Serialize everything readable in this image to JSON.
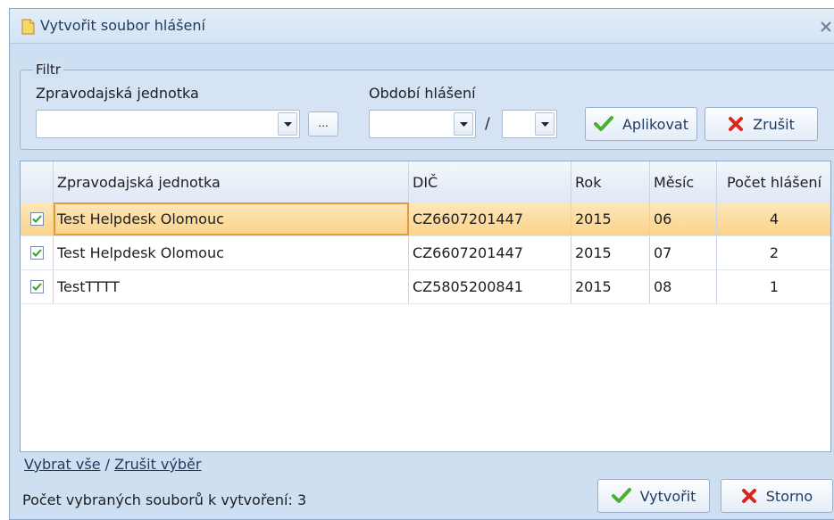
{
  "window": {
    "title": "Vytvořit soubor hlášení"
  },
  "filter": {
    "legend": "Filtr",
    "unit_label": "Zpravodajská jednotka",
    "unit_value": "",
    "period_label": "Období hlášení",
    "year_value": "",
    "month_value": "",
    "separator": "/",
    "browse_label": "...",
    "apply_label": "Aplikovat",
    "cancel_label": "Zrušit"
  },
  "grid": {
    "columns": [
      "",
      "Zpravodajská jednotka",
      "DIČ",
      "Rok",
      "Měsíc",
      "Počet hlášení"
    ],
    "rows": [
      {
        "checked": true,
        "unit": "Test Helpdesk Olomouc",
        "dic": "CZ6607201447",
        "year": "2015",
        "month": "06",
        "count": "4",
        "selected": true
      },
      {
        "checked": true,
        "unit": "Test Helpdesk Olomouc",
        "dic": "CZ6607201447",
        "year": "2015",
        "month": "07",
        "count": "2",
        "selected": false
      },
      {
        "checked": true,
        "unit": "TestTTTT",
        "dic": "CZ5805200841",
        "year": "2015",
        "month": "08",
        "count": "1",
        "selected": false
      }
    ]
  },
  "footer": {
    "select_all": "Vybrat vše",
    "link_separator": "/",
    "deselect": "Zrušit výběr",
    "status": "Počet vybraných souborů k vytvoření: 3",
    "create_label": "Vytvořit",
    "storno_label": "Storno"
  },
  "colors": {
    "accent": "#4caf2f",
    "danger": "#d9261c",
    "selection": "#fbd38a"
  }
}
